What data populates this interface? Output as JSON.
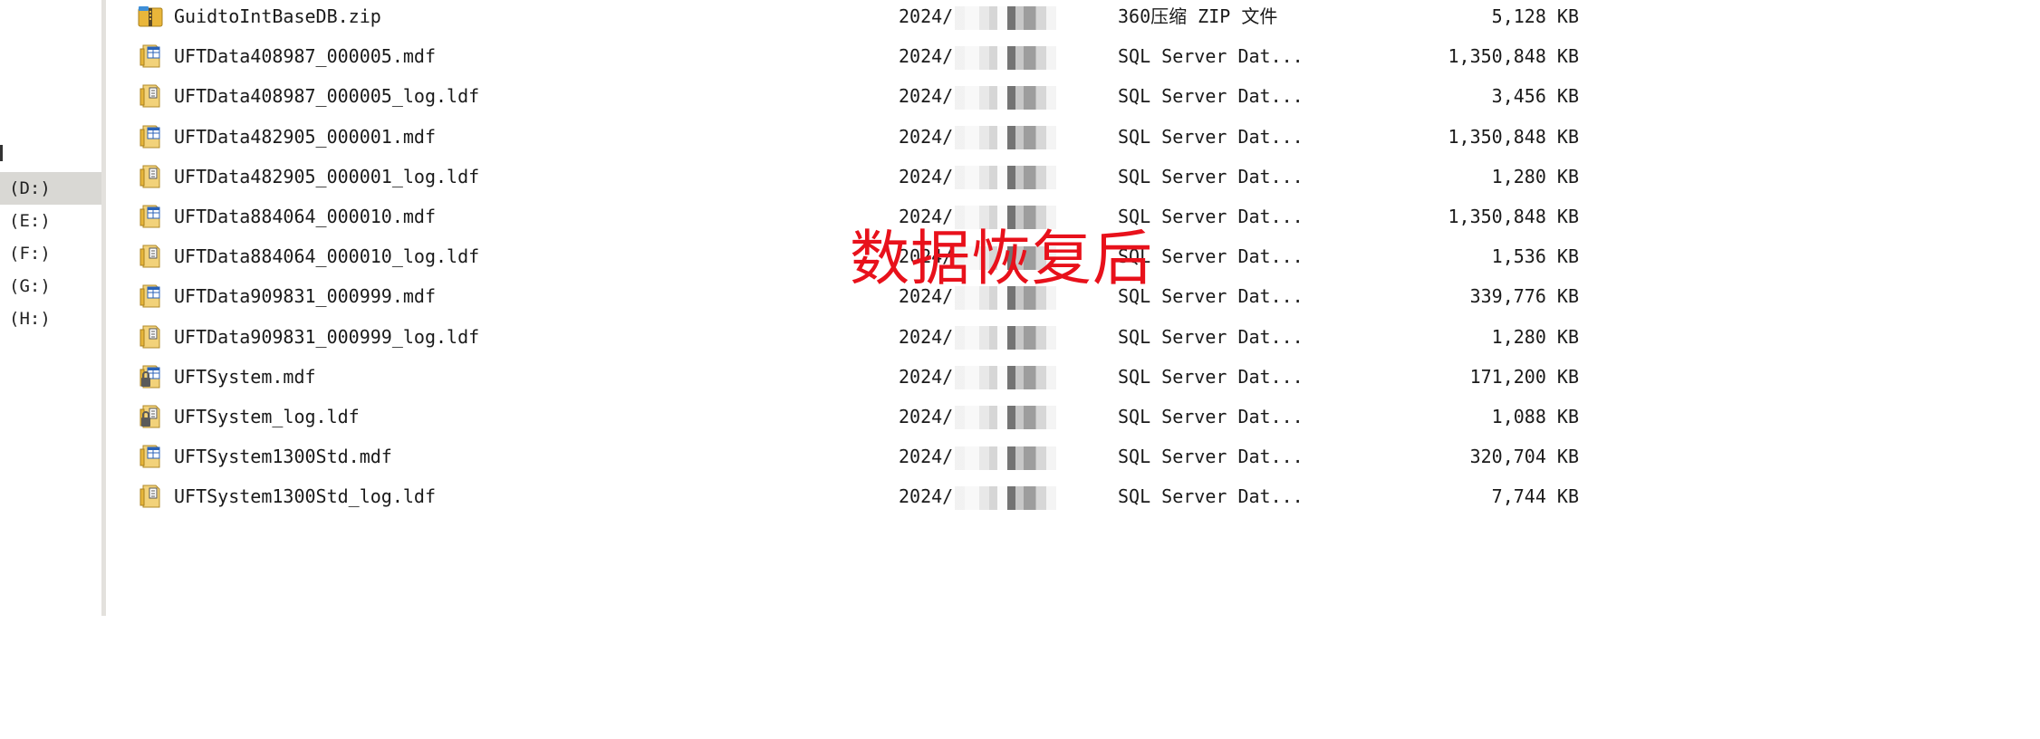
{
  "nav": {
    "drives": [
      {
        "label": "(D:)",
        "selected": true
      },
      {
        "label": "(E:)",
        "selected": false
      },
      {
        "label": "(F:)",
        "selected": false
      },
      {
        "label": "(G:)",
        "selected": false
      },
      {
        "label": "(H:)",
        "selected": false
      }
    ]
  },
  "files": [
    {
      "name": "GuidtoIntBaseDB.zip",
      "date": "2024/",
      "type": "360压缩 ZIP 文件",
      "size": "5,128 KB",
      "icon": "zip-archive-icon"
    },
    {
      "name": "UFTData408987_000005.mdf",
      "date": "2024/",
      "type": "SQL Server Dat...",
      "size": "1,350,848 KB",
      "icon": "sql-data-file-icon"
    },
    {
      "name": "UFTData408987_000005_log.ldf",
      "date": "2024/",
      "type": "SQL Server Dat...",
      "size": "3,456 KB",
      "icon": "sql-log-file-icon"
    },
    {
      "name": "UFTData482905_000001.mdf",
      "date": "2024/",
      "type": "SQL Server Dat...",
      "size": "1,350,848 KB",
      "icon": "sql-data-file-icon"
    },
    {
      "name": "UFTData482905_000001_log.ldf",
      "date": "2024/",
      "type": "SQL Server Dat...",
      "size": "1,280 KB",
      "icon": "sql-log-file-icon"
    },
    {
      "name": "UFTData884064_000010.mdf",
      "date": "2024/",
      "type": "SQL Server Dat...",
      "size": "1,350,848 KB",
      "icon": "sql-data-file-icon"
    },
    {
      "name": "UFTData884064_000010_log.ldf",
      "date": "2024/",
      "type": "SQL Server Dat...",
      "size": "1,536 KB",
      "icon": "sql-log-file-icon"
    },
    {
      "name": "UFTData909831_000999.mdf",
      "date": "2024/",
      "type": "SQL Server Dat...",
      "size": "339,776 KB",
      "icon": "sql-data-file-icon"
    },
    {
      "name": "UFTData909831_000999_log.ldf",
      "date": "2024/",
      "type": "SQL Server Dat...",
      "size": "1,280 KB",
      "icon": "sql-log-file-icon"
    },
    {
      "name": "UFTSystem.mdf",
      "date": "2024/",
      "type": "SQL Server Dat...",
      "size": "171,200 KB",
      "icon": "sql-locked-data-file-icon"
    },
    {
      "name": "UFTSystem_log.ldf",
      "date": "2024/",
      "type": "SQL Server Dat...",
      "size": "1,088 KB",
      "icon": "sql-locked-log-file-icon"
    },
    {
      "name": "UFTSystem1300Std.mdf",
      "date": "2024/",
      "type": "SQL Server Dat...",
      "size": "320,704 KB",
      "icon": "sql-data-file-icon"
    },
    {
      "name": "UFTSystem1300Std_log.ldf",
      "date": "2024/",
      "type": "SQL Server Dat...",
      "size": "7,744 KB",
      "icon": "sql-log-file-icon"
    }
  ],
  "overlay": {
    "caption": "数据恢复后",
    "color": "#e8111b"
  },
  "colors": {
    "selection": "#d9d8d4",
    "pane_border": "#e3e1dd"
  }
}
